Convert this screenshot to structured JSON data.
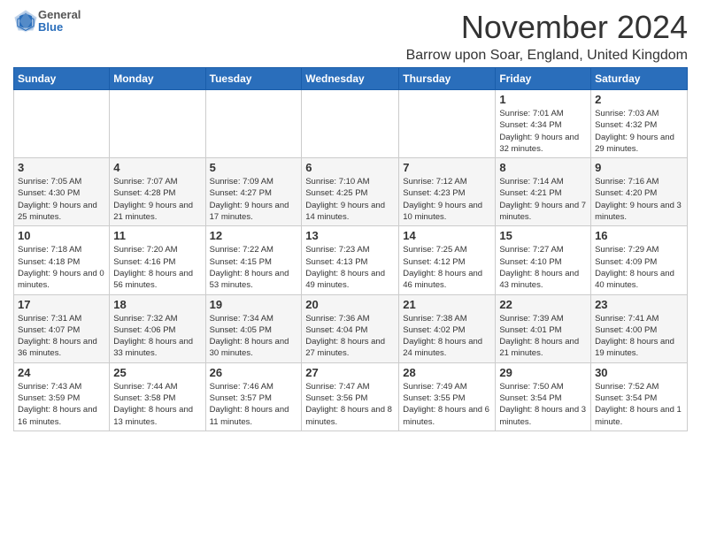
{
  "header": {
    "logo_general": "General",
    "logo_blue": "Blue",
    "month_title": "November 2024",
    "location": "Barrow upon Soar, England, United Kingdom"
  },
  "weekdays": [
    "Sunday",
    "Monday",
    "Tuesday",
    "Wednesday",
    "Thursday",
    "Friday",
    "Saturday"
  ],
  "weeks": [
    [
      {
        "day": "",
        "info": ""
      },
      {
        "day": "",
        "info": ""
      },
      {
        "day": "",
        "info": ""
      },
      {
        "day": "",
        "info": ""
      },
      {
        "day": "",
        "info": ""
      },
      {
        "day": "1",
        "info": "Sunrise: 7:01 AM\nSunset: 4:34 PM\nDaylight: 9 hours and 32 minutes."
      },
      {
        "day": "2",
        "info": "Sunrise: 7:03 AM\nSunset: 4:32 PM\nDaylight: 9 hours and 29 minutes."
      }
    ],
    [
      {
        "day": "3",
        "info": "Sunrise: 7:05 AM\nSunset: 4:30 PM\nDaylight: 9 hours and 25 minutes."
      },
      {
        "day": "4",
        "info": "Sunrise: 7:07 AM\nSunset: 4:28 PM\nDaylight: 9 hours and 21 minutes."
      },
      {
        "day": "5",
        "info": "Sunrise: 7:09 AM\nSunset: 4:27 PM\nDaylight: 9 hours and 17 minutes."
      },
      {
        "day": "6",
        "info": "Sunrise: 7:10 AM\nSunset: 4:25 PM\nDaylight: 9 hours and 14 minutes."
      },
      {
        "day": "7",
        "info": "Sunrise: 7:12 AM\nSunset: 4:23 PM\nDaylight: 9 hours and 10 minutes."
      },
      {
        "day": "8",
        "info": "Sunrise: 7:14 AM\nSunset: 4:21 PM\nDaylight: 9 hours and 7 minutes."
      },
      {
        "day": "9",
        "info": "Sunrise: 7:16 AM\nSunset: 4:20 PM\nDaylight: 9 hours and 3 minutes."
      }
    ],
    [
      {
        "day": "10",
        "info": "Sunrise: 7:18 AM\nSunset: 4:18 PM\nDaylight: 9 hours and 0 minutes."
      },
      {
        "day": "11",
        "info": "Sunrise: 7:20 AM\nSunset: 4:16 PM\nDaylight: 8 hours and 56 minutes."
      },
      {
        "day": "12",
        "info": "Sunrise: 7:22 AM\nSunset: 4:15 PM\nDaylight: 8 hours and 53 minutes."
      },
      {
        "day": "13",
        "info": "Sunrise: 7:23 AM\nSunset: 4:13 PM\nDaylight: 8 hours and 49 minutes."
      },
      {
        "day": "14",
        "info": "Sunrise: 7:25 AM\nSunset: 4:12 PM\nDaylight: 8 hours and 46 minutes."
      },
      {
        "day": "15",
        "info": "Sunrise: 7:27 AM\nSunset: 4:10 PM\nDaylight: 8 hours and 43 minutes."
      },
      {
        "day": "16",
        "info": "Sunrise: 7:29 AM\nSunset: 4:09 PM\nDaylight: 8 hours and 40 minutes."
      }
    ],
    [
      {
        "day": "17",
        "info": "Sunrise: 7:31 AM\nSunset: 4:07 PM\nDaylight: 8 hours and 36 minutes."
      },
      {
        "day": "18",
        "info": "Sunrise: 7:32 AM\nSunset: 4:06 PM\nDaylight: 8 hours and 33 minutes."
      },
      {
        "day": "19",
        "info": "Sunrise: 7:34 AM\nSunset: 4:05 PM\nDaylight: 8 hours and 30 minutes."
      },
      {
        "day": "20",
        "info": "Sunrise: 7:36 AM\nSunset: 4:04 PM\nDaylight: 8 hours and 27 minutes."
      },
      {
        "day": "21",
        "info": "Sunrise: 7:38 AM\nSunset: 4:02 PM\nDaylight: 8 hours and 24 minutes."
      },
      {
        "day": "22",
        "info": "Sunrise: 7:39 AM\nSunset: 4:01 PM\nDaylight: 8 hours and 21 minutes."
      },
      {
        "day": "23",
        "info": "Sunrise: 7:41 AM\nSunset: 4:00 PM\nDaylight: 8 hours and 19 minutes."
      }
    ],
    [
      {
        "day": "24",
        "info": "Sunrise: 7:43 AM\nSunset: 3:59 PM\nDaylight: 8 hours and 16 minutes."
      },
      {
        "day": "25",
        "info": "Sunrise: 7:44 AM\nSunset: 3:58 PM\nDaylight: 8 hours and 13 minutes."
      },
      {
        "day": "26",
        "info": "Sunrise: 7:46 AM\nSunset: 3:57 PM\nDaylight: 8 hours and 11 minutes."
      },
      {
        "day": "27",
        "info": "Sunrise: 7:47 AM\nSunset: 3:56 PM\nDaylight: 8 hours and 8 minutes."
      },
      {
        "day": "28",
        "info": "Sunrise: 7:49 AM\nSunset: 3:55 PM\nDaylight: 8 hours and 6 minutes."
      },
      {
        "day": "29",
        "info": "Sunrise: 7:50 AM\nSunset: 3:54 PM\nDaylight: 8 hours and 3 minutes."
      },
      {
        "day": "30",
        "info": "Sunrise: 7:52 AM\nSunset: 3:54 PM\nDaylight: 8 hours and 1 minute."
      }
    ]
  ]
}
